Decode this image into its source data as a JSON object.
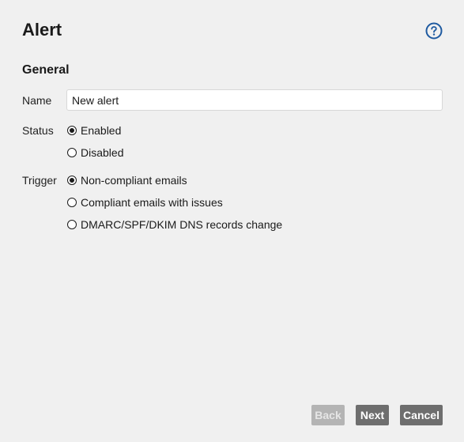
{
  "dialog": {
    "title": "Alert",
    "section": "General"
  },
  "help": {
    "icon": "help-icon",
    "color": "#1e5aa0"
  },
  "name": {
    "label": "Name",
    "value": "New alert"
  },
  "status": {
    "label": "Status",
    "options": [
      "Enabled",
      "Disabled"
    ],
    "selected": "Enabled"
  },
  "trigger": {
    "label": "Trigger",
    "options": [
      "Non-compliant emails",
      "Compliant emails with issues",
      "DMARC/SPF/DKIM DNS records change"
    ],
    "selected": "Non-compliant emails"
  },
  "buttons": {
    "back": "Back",
    "next": "Next",
    "cancel": "Cancel"
  }
}
